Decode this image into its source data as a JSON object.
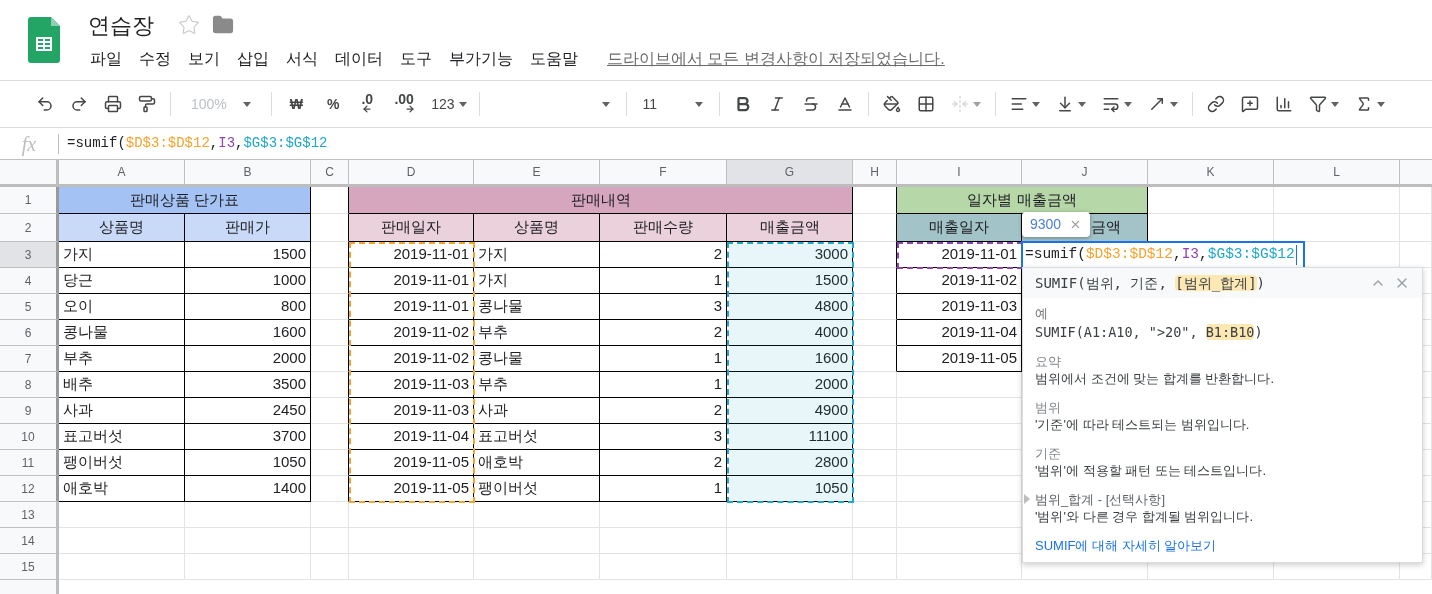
{
  "document": {
    "title": "연습장",
    "starred": false
  },
  "menus": [
    "파일",
    "수정",
    "보기",
    "삽입",
    "서식",
    "데이터",
    "도구",
    "부가기능",
    "도움말"
  ],
  "save_status": "드라이브에서 모든 변경사항이 저장되었습니다.",
  "toolbar": {
    "zoom": {
      "label": "100%",
      "disabled": true
    },
    "number_formats": [
      {
        "label": "₩",
        "kind": "plain"
      },
      {
        "label": "%",
        "kind": "plain"
      },
      {
        "label": ".0",
        "kind": "decrease"
      },
      {
        "label": ".00",
        "kind": "increase"
      },
      {
        "label": "123",
        "kind": "more"
      }
    ],
    "font_size": "11",
    "merge_disabled": true
  },
  "formula_bar": {
    "label": "fx",
    "tokens": [
      {
        "text": "=sumif("
      },
      {
        "text": "$D$3:$D$12",
        "color": "#f4a32c"
      },
      {
        "text": ","
      },
      {
        "text": "I3",
        "color": "#8e44ad"
      },
      {
        "text": ","
      },
      {
        "text": "$G$3:$G$12",
        "color": "#1fa7c9"
      }
    ]
  },
  "sheet": {
    "columns": [
      {
        "label": "A",
        "selected": false
      },
      {
        "label": "B",
        "selected": false
      },
      {
        "label": "C",
        "selected": false
      },
      {
        "label": "D",
        "selected": false
      },
      {
        "label": "E",
        "selected": false
      },
      {
        "label": "F",
        "selected": false
      },
      {
        "label": "G",
        "selected": true
      },
      {
        "label": "H",
        "selected": false
      },
      {
        "label": "I",
        "selected": false
      },
      {
        "label": "J",
        "selected": false
      },
      {
        "label": "K",
        "selected": false
      },
      {
        "label": "L",
        "selected": false
      }
    ],
    "rows": [
      {
        "label": "1",
        "selected": false
      },
      {
        "label": "2",
        "selected": false
      },
      {
        "label": "3",
        "selected": true
      },
      {
        "label": "4",
        "selected": false
      },
      {
        "label": "5",
        "selected": false
      },
      {
        "label": "6",
        "selected": false
      },
      {
        "label": "7",
        "selected": false
      },
      {
        "label": "8",
        "selected": false
      },
      {
        "label": "9",
        "selected": false
      },
      {
        "label": "10",
        "selected": false
      },
      {
        "label": "11",
        "selected": false
      },
      {
        "label": "12",
        "selected": false
      },
      {
        "label": "13",
        "selected": false
      },
      {
        "label": "14",
        "selected": false
      },
      {
        "label": "15",
        "selected": false
      }
    ]
  },
  "price_table": {
    "title": "판매상품 단가표",
    "headers": [
      {
        "text": "상품명"
      },
      {
        "text": "판매가"
      }
    ],
    "rows": [
      [
        "가지",
        "1500"
      ],
      [
        "당근",
        "1000"
      ],
      [
        "오이",
        "800"
      ],
      [
        "콩나물",
        "1600"
      ],
      [
        "부추",
        "2000"
      ],
      [
        "배추",
        "3500"
      ],
      [
        "사과",
        "2450"
      ],
      [
        "표고버섯",
        "3700"
      ],
      [
        "팽이버섯",
        "1050"
      ],
      [
        "애호박",
        "1400"
      ]
    ]
  },
  "sales_table": {
    "title": "판매내역",
    "headers": [
      {
        "text": "판매일자",
        "reference": {
          "color": "#f4a32c",
          "active": false
        }
      },
      {
        "text": "상품명"
      },
      {
        "text": "판매수량"
      },
      {
        "text": "매출금액",
        "reference": {
          "color": "#1fa7c9",
          "active": true
        }
      }
    ],
    "rows": [
      [
        "2019-11-01",
        "가지",
        "2",
        "3000"
      ],
      [
        "2019-11-01",
        "가지",
        "1",
        "1500"
      ],
      [
        "2019-11-01",
        "콩나물",
        "3",
        "4800"
      ],
      [
        "2019-11-02",
        "부추",
        "2",
        "4000"
      ],
      [
        "2019-11-02",
        "콩나물",
        "1",
        "1600"
      ],
      [
        "2019-11-03",
        "부추",
        "1",
        "2000"
      ],
      [
        "2019-11-03",
        "사과",
        "2",
        "4900"
      ],
      [
        "2019-11-04",
        "표고버섯",
        "3",
        "11100"
      ],
      [
        "2019-11-05",
        "애호박",
        "2",
        "2800"
      ],
      [
        "2019-11-05",
        "팽이버섯",
        "1",
        "1050"
      ]
    ]
  },
  "daily_table": {
    "title": "일자별 매출금액",
    "headers": [
      {
        "text": "매출일자"
      },
      {
        "text": "금액"
      }
    ],
    "dates": [
      {
        "text": "2019-11-01",
        "reference": {
          "color": "#8e44ad",
          "active": false
        }
      },
      {
        "text": "2019-11-02"
      },
      {
        "text": "2019-11-03"
      },
      {
        "text": "2019-11-04"
      },
      {
        "text": "2019-11-05"
      }
    ]
  },
  "editor": {
    "tokens": [
      {
        "text": "=sumif("
      },
      {
        "text": "$D$3:$D$12",
        "color": "#f4a32c"
      },
      {
        "text": ","
      },
      {
        "text": "I3",
        "color": "#8e44ad"
      },
      {
        "text": ","
      },
      {
        "text": "$G$3:$G$12",
        "color": "#1fa7c9"
      }
    ],
    "preview": "9300"
  },
  "help": {
    "signature": {
      "prefix": "SUMIF(범위, 기준, ",
      "highlight": "[범위_합계]",
      "suffix": ")"
    },
    "example": {
      "heading": "예",
      "prefix": "SUMIF(A1:A10, \">20\", ",
      "highlight": "B1:B10",
      "suffix": ")"
    },
    "sections": [
      {
        "heading": "요약",
        "body": "범위에서 조건에 맞는 합계를 반환합니다.",
        "current": false
      },
      {
        "heading": "범위",
        "body": "'기준'에 따라 테스트되는 범위입니다.",
        "current": false
      },
      {
        "heading": "기준",
        "body": "'범위'에 적용할 패턴 또는 테스트입니다.",
        "current": false
      },
      {
        "heading": "범위_합계 - [선택사항]",
        "body": "'범위'와 다른 경우 합계될 범위입니다.",
        "current": true
      }
    ],
    "link": "SUMIF에 대해 자세히 알아보기"
  }
}
